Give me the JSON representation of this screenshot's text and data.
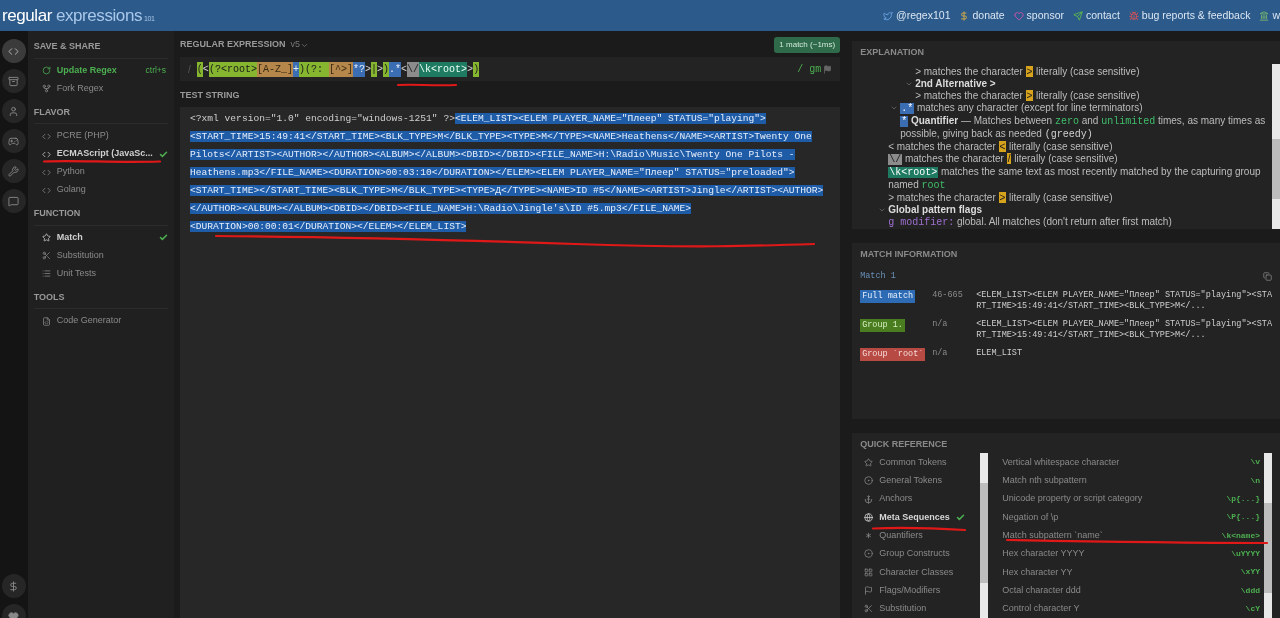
{
  "header": {
    "logo": "regular expressions",
    "logo_suffix": "101",
    "links": [
      "@regex101",
      "donate",
      "sponsor",
      "contact",
      "bug reports & feedback",
      "w"
    ]
  },
  "sidebar": {
    "sections": [
      {
        "title": "SAVE & SHARE",
        "items": [
          {
            "label": "Update Regex",
            "kind": "primary",
            "shortcut": "ctrl+s",
            "selected": false
          },
          {
            "label": "Fork Regex",
            "kind": "normal",
            "selected": false
          }
        ]
      },
      {
        "title": "FLAVOR",
        "items": [
          {
            "label": "PCRE (PHP)",
            "kind": "normal",
            "selected": false
          },
          {
            "label": "ECMAScript (JavaSc...",
            "kind": "normal",
            "selected": true
          },
          {
            "label": "Python",
            "kind": "normal",
            "selected": false
          },
          {
            "label": "Golang",
            "kind": "normal",
            "selected": false
          }
        ]
      },
      {
        "title": "FUNCTION",
        "items": [
          {
            "label": "Match",
            "kind": "normal",
            "selected": true
          },
          {
            "label": "Substitution",
            "kind": "normal",
            "selected": false
          },
          {
            "label": "Unit Tests",
            "kind": "normal",
            "selected": false
          }
        ]
      },
      {
        "title": "TOOLS",
        "items": [
          {
            "label": "Code Generator",
            "kind": "normal",
            "selected": false
          }
        ]
      }
    ]
  },
  "regex": {
    "title": "REGULAR EXPRESSION",
    "version": "v5",
    "match_badge": "1 match (~1ms)",
    "delimiter": "/",
    "flags": "/ gm",
    "tokens": [
      {
        "text": "(",
        "kind": "group"
      },
      {
        "text": "<",
        "kind": "plain"
      },
      {
        "text": "(?<root>",
        "kind": "group"
      },
      {
        "text": "[A-Z_]",
        "kind": "class"
      },
      {
        "text": "+",
        "kind": "quant"
      },
      {
        "text": ")",
        "kind": "group"
      },
      {
        "text": "(?: ",
        "kind": "group"
      },
      {
        "text": "[^>]",
        "kind": "class"
      },
      {
        "text": "*?",
        "kind": "quant"
      },
      {
        "text": ">",
        "kind": "plain"
      },
      {
        "text": "|",
        "kind": "group"
      },
      {
        "text": ">",
        "kind": "plain"
      },
      {
        "text": ")",
        "kind": "group"
      },
      {
        "text": ".*",
        "kind": "quant"
      },
      {
        "text": "<",
        "kind": "plain"
      },
      {
        "text": "\\/",
        "kind": "escape"
      },
      {
        "text": "\\k<root>",
        "kind": "backref"
      },
      {
        "text": ">",
        "kind": "plain"
      },
      {
        "text": ")",
        "kind": "group"
      }
    ]
  },
  "test_string": {
    "title": "TEST STRING",
    "lines": [
      {
        "plain": "<?xml version=\"1.0\" encoding=\"windows-1251\" ?>",
        "matched": "<ELEM_LIST><ELEM PLAYER_NAME=\"Плеер\" STATUS=\"playing\">"
      },
      {
        "matched": "<START_TIME>15:49:41</START_TIME><BLK_TYPE>М</BLK_TYPE><TYPE>М</TYPE><NAME>Heathens</NAME><ARTIST>Twenty One"
      },
      {
        "matched": "Pilots</ARTIST><AUTHOR></AUTHOR><ALBUM></ALBUM><DBID></DBID><FILE_NAME>H:\\Radio\\Music\\Twenty One Pilots -"
      },
      {
        "matched": "Heathens.mp3</FILE_NAME><DURATION>00:03:10</DURATION></ELEM><ELEM PLAYER_NAME=\"Плеер\" STATUS=\"preloaded\">"
      },
      {
        "matched": "<START_TIME></START_TIME><BLK_TYPE>М</BLK_TYPE><TYPE>Д</TYPE><NAME>ID #5</NAME><ARTIST>Jingle</ARTIST><AUTHOR>"
      },
      {
        "matched": "</AUTHOR><ALBUM></ALBUM><DBID></DBID><FILE_NAME>H:\\Radio\\Jingle's\\ID #5.mp3</FILE_NAME>"
      },
      {
        "matched": "<DURATION>00:00:01</DURATION></ELEM></ELEM_LIST>"
      }
    ]
  },
  "explanation": {
    "title": "EXPLANATION",
    "scrolled_parts": [
      [
        {
          "parts": [
            {
              "text": "> matches the character ",
              "kind": "plain"
            },
            {
              "text": ">",
              "kind": "char"
            },
            {
              "text": " literally (case sensitive)",
              "kind": "plain"
            }
          ]
        },
        {
          "expanded": true,
          "parts": [
            {
              "text": "2nd Alternative >",
              "kind": "bold"
            }
          ],
          "children": [
            {
              "parts": [
                {
                  "text": "> matches the character ",
                  "kind": "plain"
                },
                {
                  "text": ">",
                  "kind": "char"
                },
                {
                  "text": " literally (case sensitive)",
                  "kind": "plain"
                }
              ]
            }
          ]
        }
      ],
      [
        {
          "expanded": true,
          "parts": [
            {
              "text": ".*",
              "kind": "tok-quant"
            },
            {
              "text": " matches any character (except for line terminators)",
              "kind": "plain"
            }
          ],
          "children": [
            {
              "parts": [
                {
                  "text": "*",
                  "kind": "tok-quant"
                },
                {
                  "text": " Quantifier",
                  "kind": "bold"
                },
                {
                  "text": " — Matches between ",
                  "kind": "plain"
                },
                {
                  "text": "zero",
                  "kind": "code"
                },
                {
                  "text": " and ",
                  "kind": "plain"
                },
                {
                  "text": "unlimited",
                  "kind": "code"
                },
                {
                  "text": " times, as many times as possible, giving back as needed ",
                  "kind": "plain"
                },
                {
                  "text": "(greedy)",
                  "kind": "mono"
                }
              ]
            }
          ]
        }
      ]
    ],
    "items": [
      {
        "parts": [
          {
            "text": "< matches the character ",
            "kind": "plain"
          },
          {
            "text": "<",
            "kind": "char"
          },
          {
            "text": " literally (case sensitive)",
            "kind": "plain"
          }
        ]
      },
      {
        "parts": [
          {
            "text": "\\/",
            "kind": "tok-escape"
          },
          {
            "text": " matches the character ",
            "kind": "plain"
          },
          {
            "text": "/",
            "kind": "char"
          },
          {
            "text": " literally (case sensitive)",
            "kind": "plain"
          }
        ]
      },
      {
        "parts": [
          {
            "text": "\\k<root>",
            "kind": "tok-backref"
          },
          {
            "text": " matches the same text as most recently matched by the capturing group named ",
            "kind": "plain"
          },
          {
            "text": "root",
            "kind": "code"
          }
        ]
      },
      {
        "parts": [
          {
            "text": "> matches the character ",
            "kind": "plain"
          },
          {
            "text": ">",
            "kind": "char"
          },
          {
            "text": " literally (case sensitive)",
            "kind": "plain"
          }
        ]
      },
      {
        "expanded": true,
        "parts": [
          {
            "text": "Global pattern flags",
            "kind": "bold"
          }
        ],
        "children": [
          {
            "parts": [
              {
                "text": "g modifier:",
                "kind": "flag"
              },
              {
                "text": " global. All matches (don't return after first match)",
                "kind": "plain"
              }
            ]
          }
        ]
      }
    ]
  },
  "match_info": {
    "title": "MATCH INFORMATION",
    "match_label": "Match 1",
    "rows": [
      {
        "label": "Full match",
        "kind": "full",
        "range": "46-665",
        "value": "<ELEM_LIST><ELEM PLAYER_NAME=\"Плеер\" STATUS=\"playing\"><START_TIME>15:49:41</START_TIME><BLK_TYPE>М</..."
      },
      {
        "label": "Group 1.",
        "kind": "group",
        "range": "n/a",
        "value": "<ELEM_LIST><ELEM PLAYER_NAME=\"Плеер\" STATUS=\"playing\"><START_TIME>15:49:41</START_TIME><BLK_TYPE>М</..."
      },
      {
        "label": "Group `root`",
        "kind": "named",
        "range": "n/a",
        "value": "ELEM_LIST"
      }
    ]
  },
  "quick_reference": {
    "title": "QUICK REFERENCE",
    "categories": [
      {
        "label": "Common Tokens",
        "selected": false
      },
      {
        "label": "General Tokens",
        "selected": false
      },
      {
        "label": "Anchors",
        "selected": false
      },
      {
        "label": "Meta Sequences",
        "selected": true
      },
      {
        "label": "Quantifiers",
        "selected": false
      },
      {
        "label": "Group Constructs",
        "selected": false
      },
      {
        "label": "Character Classes",
        "selected": false
      },
      {
        "label": "Flags/Modifiers",
        "selected": false
      },
      {
        "label": "Substitution",
        "selected": false
      }
    ],
    "entries": [
      {
        "description": "Vertical whitespace character",
        "token": "\\v"
      },
      {
        "description": "Match nth subpattern",
        "token": "\\n"
      },
      {
        "description": "Unicode property or script category",
        "token": "\\p{...}"
      },
      {
        "description": "Negation of \\p",
        "token": "\\P{...}"
      },
      {
        "description": "Match subpattern `name`",
        "token": "\\k<name>"
      },
      {
        "description": "Hex character YYYY",
        "token": "\\uYYYY"
      },
      {
        "description": "Hex character YY",
        "token": "\\xYY"
      },
      {
        "description": "Octal character ddd",
        "token": "\\ddd"
      },
      {
        "description": "Control character Y",
        "token": "\\cY"
      }
    ]
  }
}
